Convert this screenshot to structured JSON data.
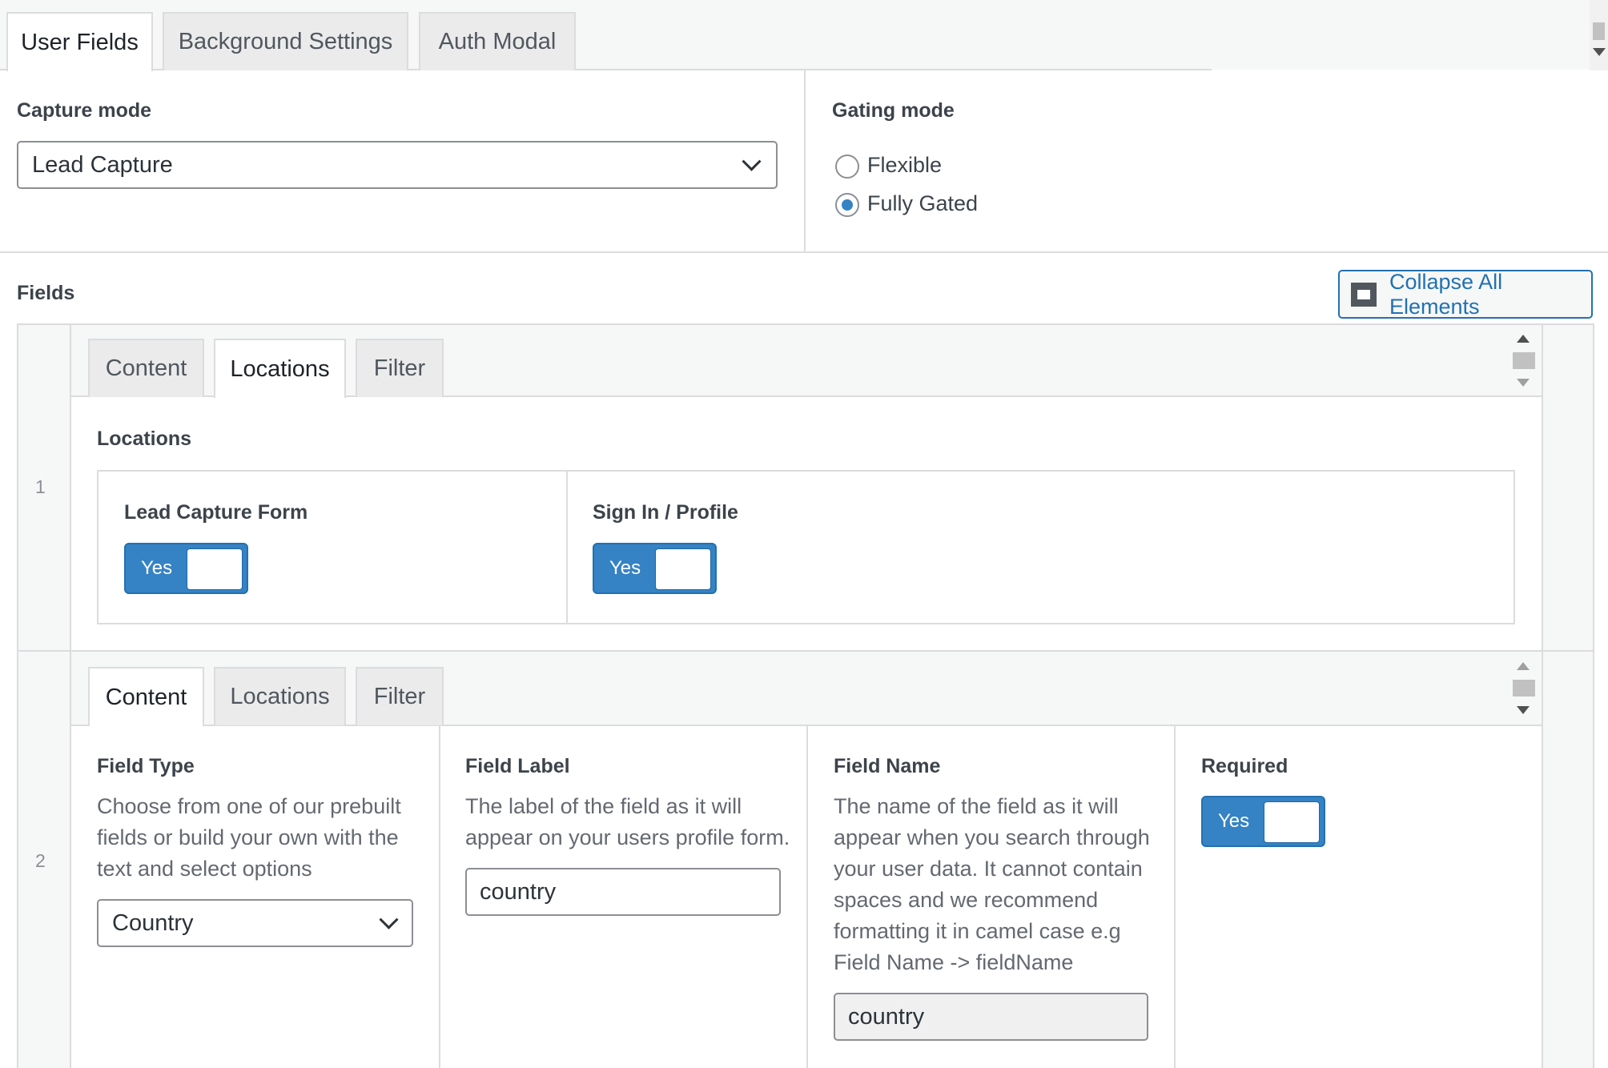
{
  "top_tabs": [
    "User Fields",
    "Background Settings",
    "Auth Modal"
  ],
  "capture": {
    "label": "Capture mode",
    "value": "Lead Capture"
  },
  "gating": {
    "label": "Gating mode",
    "options": [
      {
        "label": "Flexible",
        "checked": false
      },
      {
        "label": "Fully Gated",
        "checked": true
      }
    ]
  },
  "fields_label": "Fields",
  "collapse_button": "Collapse All Elements",
  "rows": [
    {
      "number": "1",
      "tabs": [
        "Content",
        "Locations",
        "Filter"
      ],
      "active_tab": "Locations",
      "locations": {
        "title": "Locations",
        "items": [
          {
            "label": "Lead Capture Form",
            "toggle": "Yes"
          },
          {
            "label": "Sign In / Profile",
            "toggle": "Yes"
          }
        ]
      }
    },
    {
      "number": "2",
      "tabs": [
        "Content",
        "Locations",
        "Filter"
      ],
      "active_tab": "Content",
      "content": {
        "field_type": {
          "label": "Field Type",
          "description": "Choose from one of our prebuilt fields or build your own with the text and select options",
          "value": "Country"
        },
        "field_label": {
          "label": "Field Label",
          "description": "The label of the field as it will appear on your users profile form.",
          "value": "country"
        },
        "field_name": {
          "label": "Field Name",
          "description": "The name of the field as it will appear when you search through your user data. It cannot contain spaces and we recommend formatting it in camel case e.g Field Name -> fieldName",
          "value": "country"
        },
        "required": {
          "label": "Required",
          "toggle": "Yes"
        }
      }
    }
  ],
  "colors": {
    "accent": "#2271b1",
    "toggle_on": "#3582c4",
    "border": "#dcdcde",
    "muted_text": "#646970"
  }
}
